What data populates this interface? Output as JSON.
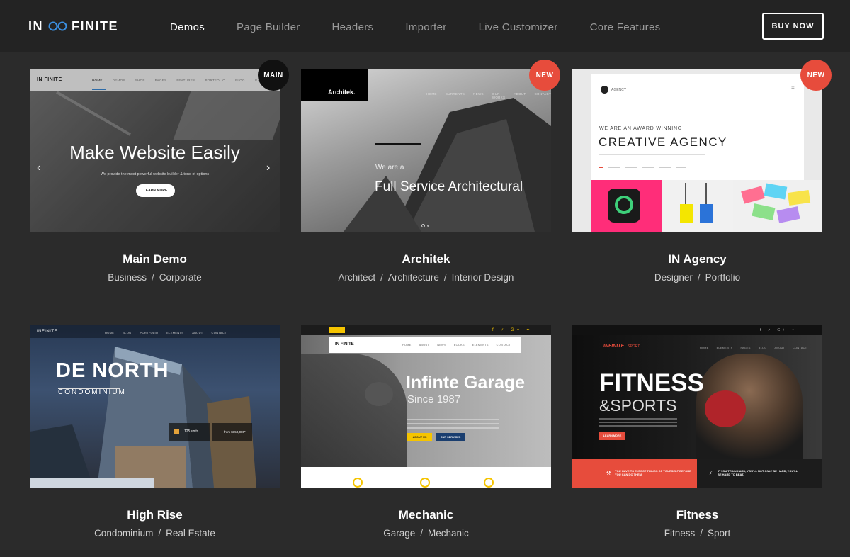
{
  "header": {
    "logo_left": "IN",
    "logo_right": "FINITE",
    "nav": [
      "Demos",
      "Page Builder",
      "Headers",
      "Importer",
      "Live Customizer",
      "Core Features"
    ],
    "buy_label": "BUY NOW"
  },
  "colors": {
    "accent_red": "#e74c3c",
    "badge_black": "#111111",
    "background": "#2b2b2b",
    "header": "#232323"
  },
  "demos": [
    {
      "title": "Main Demo",
      "tags": [
        "Business",
        "Corporate"
      ],
      "badge": "MAIN",
      "preview": {
        "logo": "IN FINITE",
        "nav": [
          "HOME",
          "DEMOS",
          "SHOP",
          "PAGES",
          "FEATURES",
          "PORTFOLIO",
          "BLOG",
          "GALLERY"
        ],
        "headline": "Make Website Easily",
        "sub": "We provide the most powerful website builder & tons of options",
        "cta": "LEARN MORE"
      }
    },
    {
      "title": "Architek",
      "tags": [
        "Architect",
        "Architecture",
        "Interior Design"
      ],
      "badge": "NEW",
      "preview": {
        "logo": "Architek.",
        "nav": [
          "HOME",
          "CURRENTS",
          "NEWS",
          "OUR WORKS",
          "ABOUT",
          "CONTACT"
        ],
        "pre": "We are a",
        "headline": "Full Service Architectural"
      }
    },
    {
      "title": "IN Agency",
      "tags": [
        "Designer",
        "Portfolio"
      ],
      "badge": "NEW",
      "preview": {
        "brand": "AGENCY",
        "pre": "WE ARE AN AWARD WINNING",
        "headline": "CREATIVE AGENCY"
      }
    },
    {
      "title": "High Rise",
      "tags": [
        "Condominium",
        "Real Estate"
      ],
      "preview": {
        "logo": "INFINITE",
        "nav": [
          "HOME",
          "BLOG",
          "PORTFOLIO",
          "ELEMENTS",
          "ABOUT",
          "CONTACT"
        ],
        "headline": "DE NORTH",
        "sub": "CONDOMINIUM",
        "stat1": "125 units",
        "stat2": "from $150,000*"
      }
    },
    {
      "title": "Mechanic",
      "tags": [
        "Garage",
        "Mechanic"
      ],
      "preview": {
        "logo": "IN FINITE",
        "nav": [
          "HOME",
          "ABOUT",
          "NEWS",
          "BOOKS",
          "ELEMENTS",
          "CONTACT"
        ],
        "headline": "Infinte Garage",
        "sub": "Since 1987",
        "btn1": "ABOUT US",
        "btn2": "OUR SERVICES"
      }
    },
    {
      "title": "Fitness",
      "tags": [
        "Fitness",
        "Sport"
      ],
      "preview": {
        "logo": "INFINITE",
        "logo_small": "SPORT",
        "nav": [
          "HOME",
          "ELEMENTS",
          "PAGES",
          "BLOG",
          "ABOUT",
          "CONTACT"
        ],
        "headline": "FITNESS",
        "sub": "&SPORTS",
        "cta": "LEARN MORE",
        "banner1": "YOU HAVE TO EXPECT THINGS OF YOURSELF BEFORE YOU CAN DO THEM.",
        "banner2": "IF YOU TRAIN HARD, YOU'LL NOT ONLY BE HARD, YOU'LL BE HARD TO BEAT."
      }
    }
  ]
}
